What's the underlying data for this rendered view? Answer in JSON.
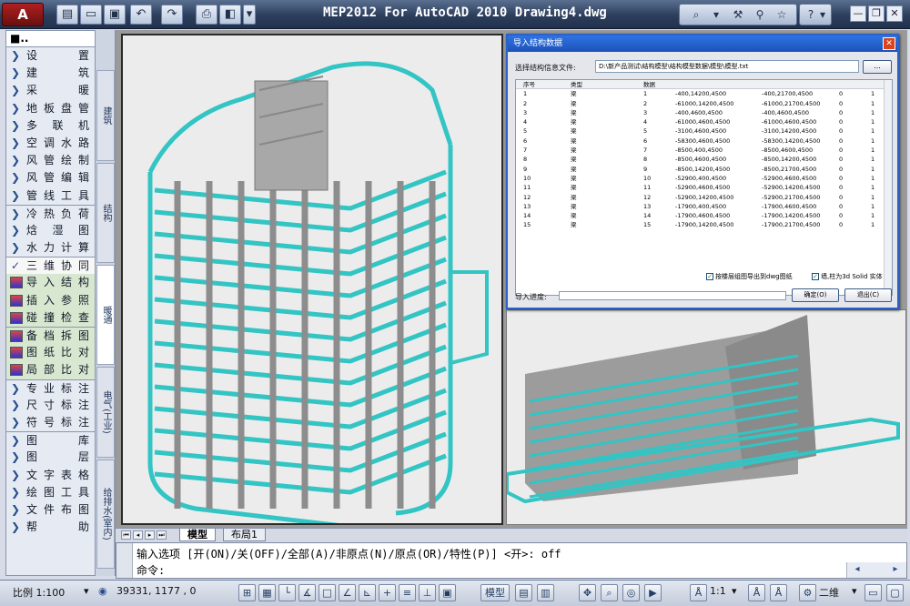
{
  "app": {
    "title": "MEP2012 For AutoCAD 2010  Drawing4.dwg",
    "logo": "A"
  },
  "sidebar": {
    "header": "■..",
    "items": [
      {
        "label": "设 置",
        "arrow": "❯"
      },
      {
        "label": "建 筑",
        "arrow": "❯"
      },
      {
        "label": "采 暖",
        "arrow": "❯"
      },
      {
        "label": "地板盘管",
        "arrow": "❯"
      },
      {
        "label": "多 联 机",
        "arrow": "❯"
      },
      {
        "label": "空调水路",
        "arrow": "❯"
      },
      {
        "label": "风管绘制",
        "arrow": "❯"
      },
      {
        "label": "风管编辑",
        "arrow": "❯"
      },
      {
        "label": "管线工具",
        "arrow": "❯"
      },
      {
        "label": "冷热负荷",
        "arrow": "❯"
      },
      {
        "label": "焓 湿 图",
        "arrow": "❯"
      },
      {
        "label": "水力计算",
        "arrow": "❯"
      },
      {
        "label": "三维协同",
        "arrow": "✓"
      },
      {
        "label": "导入结构",
        "icon": true
      },
      {
        "label": "插入参照",
        "icon": true
      },
      {
        "label": "碰撞检查",
        "icon": true
      },
      {
        "label": "备档拆图",
        "icon": true
      },
      {
        "label": "图纸比对",
        "icon": true
      },
      {
        "label": "局部比对",
        "icon": true
      },
      {
        "label": "专业标注",
        "arrow": "❯"
      },
      {
        "label": "尺寸标注",
        "arrow": "❯"
      },
      {
        "label": "符号标注",
        "arrow": "❯"
      },
      {
        "label": "图 库",
        "arrow": "❯"
      },
      {
        "label": "图 层",
        "arrow": "❯"
      },
      {
        "label": "文字表格",
        "arrow": "❯"
      },
      {
        "label": "绘图工具",
        "arrow": "❯"
      },
      {
        "label": "文件布图",
        "arrow": "❯"
      },
      {
        "label": "帮 助",
        "arrow": "❯"
      }
    ]
  },
  "vertical_tabs": [
    "建筑",
    "结构",
    "暖通",
    "电气(工业)",
    "给排水(室内)"
  ],
  "dialog": {
    "title": "导入结构数据",
    "file_label": "选择结构信息文件:",
    "file_path": "D:\\新产品测试\\结构模型\\结构模型数据\\模型\\模型.txt",
    "browse": "...",
    "columns": [
      "序号",
      "类型",
      "数据"
    ],
    "rows": [
      [
        "1",
        "梁",
        "1",
        "-400,14200,4500",
        "-400,21700,4500",
        "0",
        "1"
      ],
      [
        "2",
        "梁",
        "2",
        "-61000,14200,4500",
        "-61000,21700,4500",
        "0",
        "1"
      ],
      [
        "3",
        "梁",
        "3",
        "-400,4600,4500",
        "-400,4600,4500",
        "0",
        "1"
      ],
      [
        "4",
        "梁",
        "4",
        "-61000,4600,4500",
        "-61000,4600,4500",
        "0",
        "1"
      ],
      [
        "5",
        "梁",
        "5",
        "-3100,4600,4500",
        "-3100,14200,4500",
        "0",
        "1"
      ],
      [
        "6",
        "梁",
        "6",
        "-58300,4600,4500",
        "-58300,14200,4500",
        "0",
        "1"
      ],
      [
        "7",
        "梁",
        "7",
        "-8500,400,4500",
        "-8500,4600,4500",
        "0",
        "1"
      ],
      [
        "8",
        "梁",
        "8",
        "-8500,4600,4500",
        "-8500,14200,4500",
        "0",
        "1"
      ],
      [
        "9",
        "梁",
        "9",
        "-8500,14200,4500",
        "-8500,21700,4500",
        "0",
        "1"
      ],
      [
        "10",
        "梁",
        "10",
        "-52900,400,4500",
        "-52900,4600,4500",
        "0",
        "1"
      ],
      [
        "11",
        "梁",
        "11",
        "-52900,4600,4500",
        "-52900,14200,4500",
        "0",
        "1"
      ],
      [
        "12",
        "梁",
        "12",
        "-52900,14200,4500",
        "-52900,21700,4500",
        "0",
        "1"
      ],
      [
        "13",
        "梁",
        "13",
        "-17900,400,4500",
        "-17900,4600,4500",
        "0",
        "1"
      ],
      [
        "14",
        "梁",
        "14",
        "-17900,4600,4500",
        "-17900,14200,4500",
        "0",
        "1"
      ],
      [
        "15",
        "梁",
        "15",
        "-17900,14200,4500",
        "-17900,21700,4500",
        "0",
        "1"
      ]
    ],
    "check1": "按楼层组图导出到dwg图纸",
    "check2": "墙,柱为3d Solid 实体",
    "progress_label": "导入进度:",
    "ok": "确定(O)",
    "cancel": "退出(C)"
  },
  "layout_tabs": [
    "模型",
    "布局1"
  ],
  "command": {
    "line1": "输入选项 [开(ON)/关(OFF)/全部(A)/非原点(N)/原点(OR)/特性(P)] <开>: off",
    "line2": "命令:"
  },
  "status": {
    "scale": "比例 1:100",
    "coords": "39331, 1177 , 0",
    "model": "模型",
    "anno_scale": "1:1",
    "view": "二维"
  },
  "colors": {
    "beam": "#33c4c4",
    "wall": "#9a9a9a",
    "titlebar": "#2c3e5c"
  }
}
